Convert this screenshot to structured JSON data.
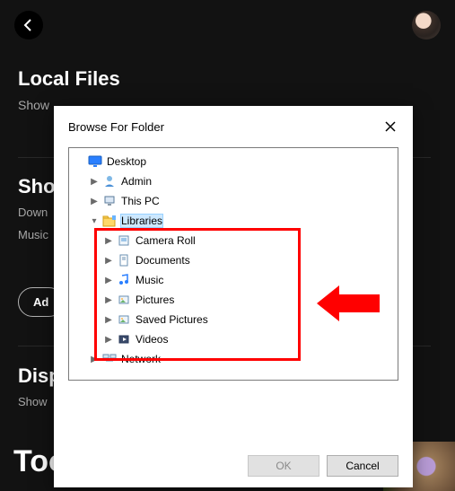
{
  "app": {
    "section_title": "Local Files",
    "show_label": "Show",
    "show_section": "Show",
    "row_downloads": "Down",
    "row_music": "Music",
    "add_btn": "Ad",
    "disp_section": "Disp",
    "show_label2": "Show",
    "footer": "Too"
  },
  "dialog": {
    "title": "Browse For Folder",
    "ok": "OK",
    "cancel": "Cancel"
  },
  "tree": {
    "desktop": "Desktop",
    "admin": "Admin",
    "thispc": "This PC",
    "libraries": "Libraries",
    "cameraroll": "Camera Roll",
    "documents": "Documents",
    "music": "Music",
    "pictures": "Pictures",
    "savedpictures": "Saved Pictures",
    "videos": "Videos",
    "network": "Network"
  }
}
